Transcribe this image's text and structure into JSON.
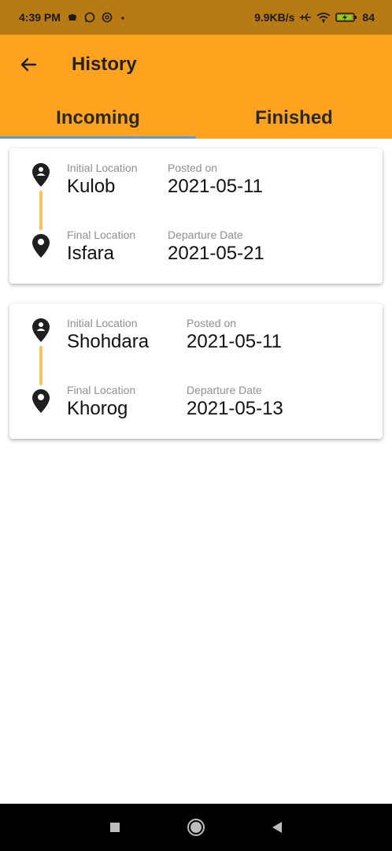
{
  "status_bar": {
    "time": "4:39 PM",
    "network_speed": "9.9KB/s",
    "battery_percent": "84",
    "icons": [
      "notification-dot-icon",
      "whatsapp-icon",
      "at-icon",
      "dot-icon",
      "airplane-icon",
      "wifi-icon",
      "battery-charging-icon"
    ]
  },
  "header": {
    "title": "History",
    "back_icon": "arrow-left-icon"
  },
  "tabs": [
    {
      "label": "Incoming",
      "active": true
    },
    {
      "label": "Finished",
      "active": false
    }
  ],
  "trips": [
    {
      "initial_label": "Initial Location",
      "initial_value": "Kulob",
      "posted_label": "Posted on",
      "posted_value": "2021-05-11",
      "final_label": "Final Location",
      "final_value": "Isfara",
      "departure_label": "Departure Date",
      "departure_value": "2021-05-21"
    },
    {
      "initial_label": "Initial Location",
      "initial_value": "Shohdara",
      "posted_label": "Posted on",
      "posted_value": "2021-05-11",
      "final_label": "Final Location",
      "final_value": "Khorog",
      "departure_label": "Departure Date",
      "departure_value": "2021-05-13"
    }
  ],
  "nav_bar": {
    "icons": [
      "square-icon",
      "circle-icon",
      "triangle-back-icon"
    ]
  },
  "colors": {
    "app_bar": "#ffa31f",
    "status_bar": "#b77a14",
    "tab_indicator": "#5b9bd6",
    "connector": "#f7c35a"
  }
}
